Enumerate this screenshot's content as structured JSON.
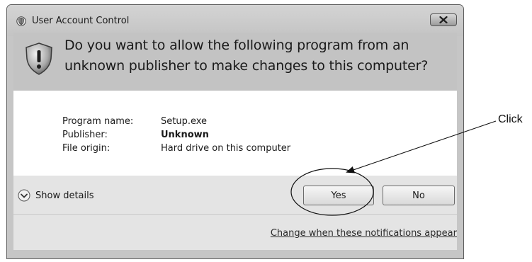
{
  "window": {
    "title": "User Account Control",
    "close_icon": "close-x-icon",
    "title_icon": "uac-shield-icon"
  },
  "header": {
    "question": "Do you want to allow the following program from an unknown publisher to make changes to this computer?",
    "icon": "warning-shield-icon"
  },
  "details": {
    "rows": [
      {
        "label": "Program name:",
        "value": "Setup.exe"
      },
      {
        "label": "Publisher:",
        "value": "Unknown"
      },
      {
        "label": "File origin:",
        "value": "Hard drive on this computer"
      }
    ]
  },
  "actions": {
    "show_details": "Show details",
    "yes_label": "Yes",
    "no_label": "No"
  },
  "footer": {
    "link": "Change when these notifications appear"
  },
  "annotation": {
    "label": "Click"
  },
  "colors": {
    "titlebar": "#c6c6c6",
    "header_band": "#c3c3c3",
    "content": "#ffffff",
    "button_band": "#e4e4e4"
  }
}
